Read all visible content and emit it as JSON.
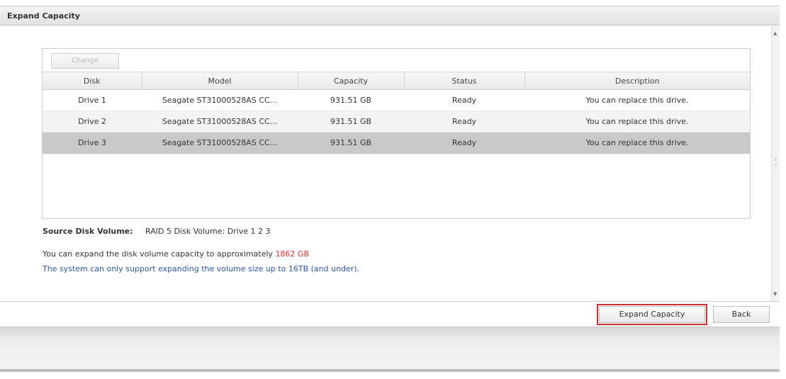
{
  "window": {
    "title": "Expand Capacity"
  },
  "toolbar": {
    "change_label": "Change"
  },
  "table": {
    "columns": [
      "Disk",
      "Model",
      "Capacity",
      "Status",
      "Description"
    ],
    "rows": [
      {
        "disk": "Drive 1",
        "model": "Seagate ST31000528AS CC...",
        "capacity": "931.51 GB",
        "status": "Ready",
        "description": "You can replace this drive.",
        "selected": false
      },
      {
        "disk": "Drive 2",
        "model": "Seagate ST31000528AS CC...",
        "capacity": "931.51 GB",
        "status": "Ready",
        "description": "You can replace this drive.",
        "selected": false
      },
      {
        "disk": "Drive 3",
        "model": "Seagate ST31000528AS CC...",
        "capacity": "931.51 GB",
        "status": "Ready",
        "description": "You can replace this drive.",
        "selected": true
      }
    ]
  },
  "info": {
    "source_label": "Source Disk Volume:",
    "source_value": "RAID 5 Disk Volume: Drive 1 2 3",
    "expand_text": "You can expand the disk volume capacity to approximately",
    "expand_amount": "1862 GB",
    "limit_text": "The system can only support expanding the volume size up to 16TB (and under)."
  },
  "footer": {
    "expand_button": "Expand Capacity",
    "back_button": "Back"
  },
  "colors": {
    "highlight_outline": "#d03030",
    "amount": "#e03030",
    "limit_text": "#2a55a8",
    "selected_row": "#c9c9c9"
  }
}
